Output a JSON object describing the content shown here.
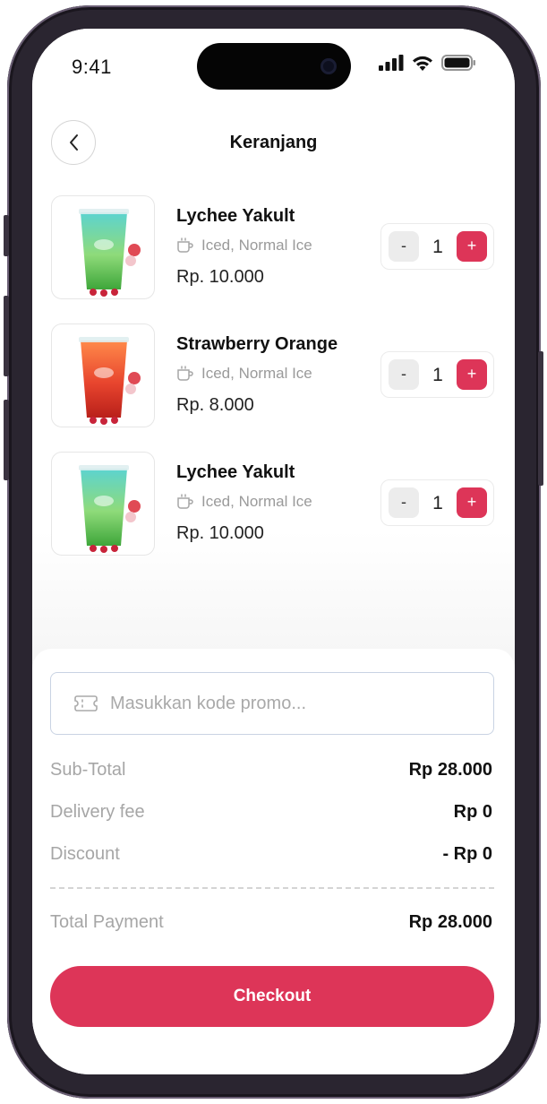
{
  "status_bar": {
    "time": "9:41"
  },
  "header": {
    "title": "Keranjang",
    "back_icon": "chevron-left-icon"
  },
  "cart": {
    "items": [
      {
        "name": "Lychee Yakult",
        "option": "Iced, Normal Ice",
        "price": "Rp. 10.000",
        "quantity": "1",
        "minus_label": "-",
        "plus_label": "+",
        "drink_colors": [
          "#5cd3d0",
          "#8fdb7a",
          "#3ea63a"
        ]
      },
      {
        "name": "Strawberry Orange",
        "option": "Iced, Normal Ice",
        "price": "Rp. 8.000",
        "quantity": "1",
        "minus_label": "-",
        "plus_label": "+",
        "drink_colors": [
          "#ff8a4a",
          "#e8452e",
          "#b9201a"
        ]
      },
      {
        "name": "Lychee Yakult",
        "option": "Iced, Normal Ice",
        "price": "Rp. 10.000",
        "quantity": "1",
        "minus_label": "-",
        "plus_label": "+",
        "drink_colors": [
          "#5cd3d0",
          "#8fdb7a",
          "#3ea63a"
        ]
      }
    ]
  },
  "promo": {
    "placeholder": "Masukkan kode promo...",
    "icon": "ticket-icon"
  },
  "summary": {
    "subtotal_label": "Sub-Total",
    "subtotal_value": "Rp 28.000",
    "delivery_label": "Delivery fee",
    "delivery_value": "Rp 0",
    "discount_label": "Discount",
    "discount_value": "- Rp 0",
    "total_label": "Total Payment",
    "total_value": "Rp 28.000"
  },
  "checkout": {
    "label": "Checkout"
  },
  "colors": {
    "accent": "#dd3558",
    "muted_text": "#a6a6a6",
    "stepper_minus_bg": "#ececec"
  }
}
